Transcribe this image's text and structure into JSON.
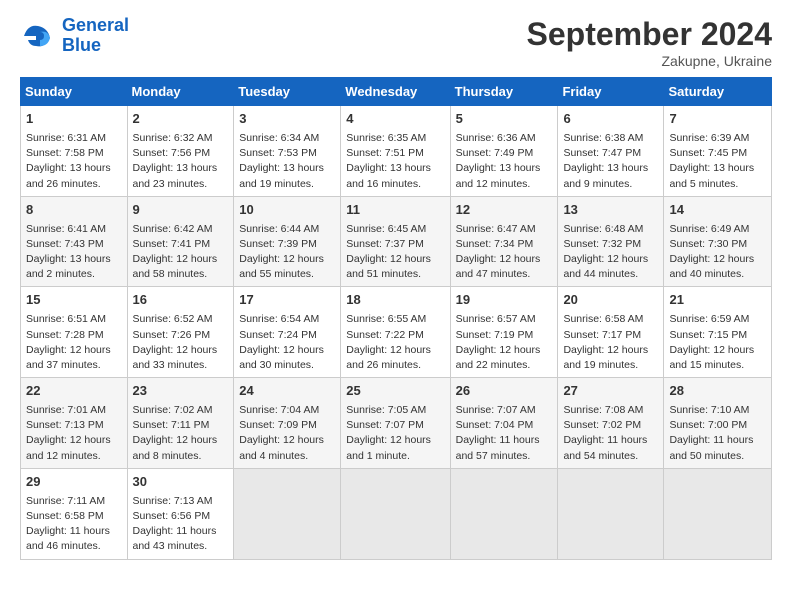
{
  "header": {
    "logo_general": "General",
    "logo_blue": "Blue",
    "month_title": "September 2024",
    "subtitle": "Zakupne, Ukraine"
  },
  "days_of_week": [
    "Sunday",
    "Monday",
    "Tuesday",
    "Wednesday",
    "Thursday",
    "Friday",
    "Saturday"
  ],
  "weeks": [
    [
      {
        "day": "1",
        "lines": [
          "Sunrise: 6:31 AM",
          "Sunset: 7:58 PM",
          "Daylight: 13 hours",
          "and 26 minutes."
        ]
      },
      {
        "day": "2",
        "lines": [
          "Sunrise: 6:32 AM",
          "Sunset: 7:56 PM",
          "Daylight: 13 hours",
          "and 23 minutes."
        ]
      },
      {
        "day": "3",
        "lines": [
          "Sunrise: 6:34 AM",
          "Sunset: 7:53 PM",
          "Daylight: 13 hours",
          "and 19 minutes."
        ]
      },
      {
        "day": "4",
        "lines": [
          "Sunrise: 6:35 AM",
          "Sunset: 7:51 PM",
          "Daylight: 13 hours",
          "and 16 minutes."
        ]
      },
      {
        "day": "5",
        "lines": [
          "Sunrise: 6:36 AM",
          "Sunset: 7:49 PM",
          "Daylight: 13 hours",
          "and 12 minutes."
        ]
      },
      {
        "day": "6",
        "lines": [
          "Sunrise: 6:38 AM",
          "Sunset: 7:47 PM",
          "Daylight: 13 hours",
          "and 9 minutes."
        ]
      },
      {
        "day": "7",
        "lines": [
          "Sunrise: 6:39 AM",
          "Sunset: 7:45 PM",
          "Daylight: 13 hours",
          "and 5 minutes."
        ]
      }
    ],
    [
      {
        "day": "8",
        "lines": [
          "Sunrise: 6:41 AM",
          "Sunset: 7:43 PM",
          "Daylight: 13 hours",
          "and 2 minutes."
        ]
      },
      {
        "day": "9",
        "lines": [
          "Sunrise: 6:42 AM",
          "Sunset: 7:41 PM",
          "Daylight: 12 hours",
          "and 58 minutes."
        ]
      },
      {
        "day": "10",
        "lines": [
          "Sunrise: 6:44 AM",
          "Sunset: 7:39 PM",
          "Daylight: 12 hours",
          "and 55 minutes."
        ]
      },
      {
        "day": "11",
        "lines": [
          "Sunrise: 6:45 AM",
          "Sunset: 7:37 PM",
          "Daylight: 12 hours",
          "and 51 minutes."
        ]
      },
      {
        "day": "12",
        "lines": [
          "Sunrise: 6:47 AM",
          "Sunset: 7:34 PM",
          "Daylight: 12 hours",
          "and 47 minutes."
        ]
      },
      {
        "day": "13",
        "lines": [
          "Sunrise: 6:48 AM",
          "Sunset: 7:32 PM",
          "Daylight: 12 hours",
          "and 44 minutes."
        ]
      },
      {
        "day": "14",
        "lines": [
          "Sunrise: 6:49 AM",
          "Sunset: 7:30 PM",
          "Daylight: 12 hours",
          "and 40 minutes."
        ]
      }
    ],
    [
      {
        "day": "15",
        "lines": [
          "Sunrise: 6:51 AM",
          "Sunset: 7:28 PM",
          "Daylight: 12 hours",
          "and 37 minutes."
        ]
      },
      {
        "day": "16",
        "lines": [
          "Sunrise: 6:52 AM",
          "Sunset: 7:26 PM",
          "Daylight: 12 hours",
          "and 33 minutes."
        ]
      },
      {
        "day": "17",
        "lines": [
          "Sunrise: 6:54 AM",
          "Sunset: 7:24 PM",
          "Daylight: 12 hours",
          "and 30 minutes."
        ]
      },
      {
        "day": "18",
        "lines": [
          "Sunrise: 6:55 AM",
          "Sunset: 7:22 PM",
          "Daylight: 12 hours",
          "and 26 minutes."
        ]
      },
      {
        "day": "19",
        "lines": [
          "Sunrise: 6:57 AM",
          "Sunset: 7:19 PM",
          "Daylight: 12 hours",
          "and 22 minutes."
        ]
      },
      {
        "day": "20",
        "lines": [
          "Sunrise: 6:58 AM",
          "Sunset: 7:17 PM",
          "Daylight: 12 hours",
          "and 19 minutes."
        ]
      },
      {
        "day": "21",
        "lines": [
          "Sunrise: 6:59 AM",
          "Sunset: 7:15 PM",
          "Daylight: 12 hours",
          "and 15 minutes."
        ]
      }
    ],
    [
      {
        "day": "22",
        "lines": [
          "Sunrise: 7:01 AM",
          "Sunset: 7:13 PM",
          "Daylight: 12 hours",
          "and 12 minutes."
        ]
      },
      {
        "day": "23",
        "lines": [
          "Sunrise: 7:02 AM",
          "Sunset: 7:11 PM",
          "Daylight: 12 hours",
          "and 8 minutes."
        ]
      },
      {
        "day": "24",
        "lines": [
          "Sunrise: 7:04 AM",
          "Sunset: 7:09 PM",
          "Daylight: 12 hours",
          "and 4 minutes."
        ]
      },
      {
        "day": "25",
        "lines": [
          "Sunrise: 7:05 AM",
          "Sunset: 7:07 PM",
          "Daylight: 12 hours",
          "and 1 minute."
        ]
      },
      {
        "day": "26",
        "lines": [
          "Sunrise: 7:07 AM",
          "Sunset: 7:04 PM",
          "Daylight: 11 hours",
          "and 57 minutes."
        ]
      },
      {
        "day": "27",
        "lines": [
          "Sunrise: 7:08 AM",
          "Sunset: 7:02 PM",
          "Daylight: 11 hours",
          "and 54 minutes."
        ]
      },
      {
        "day": "28",
        "lines": [
          "Sunrise: 7:10 AM",
          "Sunset: 7:00 PM",
          "Daylight: 11 hours",
          "and 50 minutes."
        ]
      }
    ],
    [
      {
        "day": "29",
        "lines": [
          "Sunrise: 7:11 AM",
          "Sunset: 6:58 PM",
          "Daylight: 11 hours",
          "and 46 minutes."
        ]
      },
      {
        "day": "30",
        "lines": [
          "Sunrise: 7:13 AM",
          "Sunset: 6:56 PM",
          "Daylight: 11 hours",
          "and 43 minutes."
        ]
      },
      {
        "day": "",
        "lines": [],
        "empty": true
      },
      {
        "day": "",
        "lines": [],
        "empty": true
      },
      {
        "day": "",
        "lines": [],
        "empty": true
      },
      {
        "day": "",
        "lines": [],
        "empty": true
      },
      {
        "day": "",
        "lines": [],
        "empty": true
      }
    ]
  ]
}
